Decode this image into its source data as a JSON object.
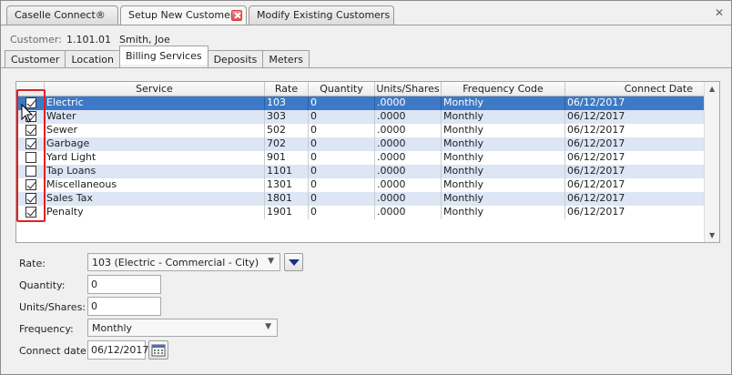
{
  "doc_tabs": [
    {
      "label": "Caselle Connect®"
    },
    {
      "label": "Setup New Customers"
    },
    {
      "label": "Modify Existing Customers"
    }
  ],
  "customer": {
    "label": "Customer:",
    "number": "1.101.01",
    "name": "Smith, Joe"
  },
  "sub_tabs": [
    "Customer",
    "Location",
    "Billing Services",
    "Deposits",
    "Meters"
  ],
  "grid": {
    "columns": [
      "Service",
      "Rate",
      "Quantity",
      "Units/Shares",
      "Frequency Code",
      "Connect Date"
    ],
    "rows": [
      {
        "checked": true,
        "service": "Electric",
        "rate": "103",
        "quantity": "0",
        "units": ".0000",
        "frequency": "Monthly",
        "date": "06/12/2017"
      },
      {
        "checked": true,
        "service": "Water",
        "rate": "303",
        "quantity": "0",
        "units": ".0000",
        "frequency": "Monthly",
        "date": "06/12/2017"
      },
      {
        "checked": true,
        "service": "Sewer",
        "rate": "502",
        "quantity": "0",
        "units": ".0000",
        "frequency": "Monthly",
        "date": "06/12/2017"
      },
      {
        "checked": true,
        "service": "Garbage",
        "rate": "702",
        "quantity": "0",
        "units": ".0000",
        "frequency": "Monthly",
        "date": "06/12/2017"
      },
      {
        "checked": false,
        "service": "Yard Light",
        "rate": "901",
        "quantity": "0",
        "units": ".0000",
        "frequency": "Monthly",
        "date": "06/12/2017"
      },
      {
        "checked": false,
        "service": "Tap Loans",
        "rate": "1101",
        "quantity": "0",
        "units": ".0000",
        "frequency": "Monthly",
        "date": "06/12/2017"
      },
      {
        "checked": true,
        "service": "Miscellaneous",
        "rate": "1301",
        "quantity": "0",
        "units": ".0000",
        "frequency": "Monthly",
        "date": "06/12/2017"
      },
      {
        "checked": true,
        "service": "Sales Tax",
        "rate": "1801",
        "quantity": "0",
        "units": ".0000",
        "frequency": "Monthly",
        "date": "06/12/2017"
      },
      {
        "checked": true,
        "service": "Penalty",
        "rate": "1901",
        "quantity": "0",
        "units": ".0000",
        "frequency": "Monthly",
        "date": "06/12/2017"
      }
    ]
  },
  "form": {
    "rate_label": "Rate:",
    "rate_value": "103  (Electric - Commercial - City)",
    "quantity_label": "Quantity:",
    "quantity_value": "0",
    "units_label": "Units/Shares:",
    "units_value": "0",
    "frequency_label": "Frequency:",
    "frequency_value": "Monthly",
    "connect_label": "Connect date:",
    "connect_value": "06/12/2017"
  },
  "colors": {
    "selected_row": "#3d79c6",
    "alt_row": "#dce6f5",
    "highlight_box": "#e02020"
  },
  "icons": [
    "tab-close-icon",
    "window-close-icon",
    "dropdown-arrow-icon",
    "calendar-icon",
    "mouse-cursor-icon",
    "checkbox-icon"
  ]
}
